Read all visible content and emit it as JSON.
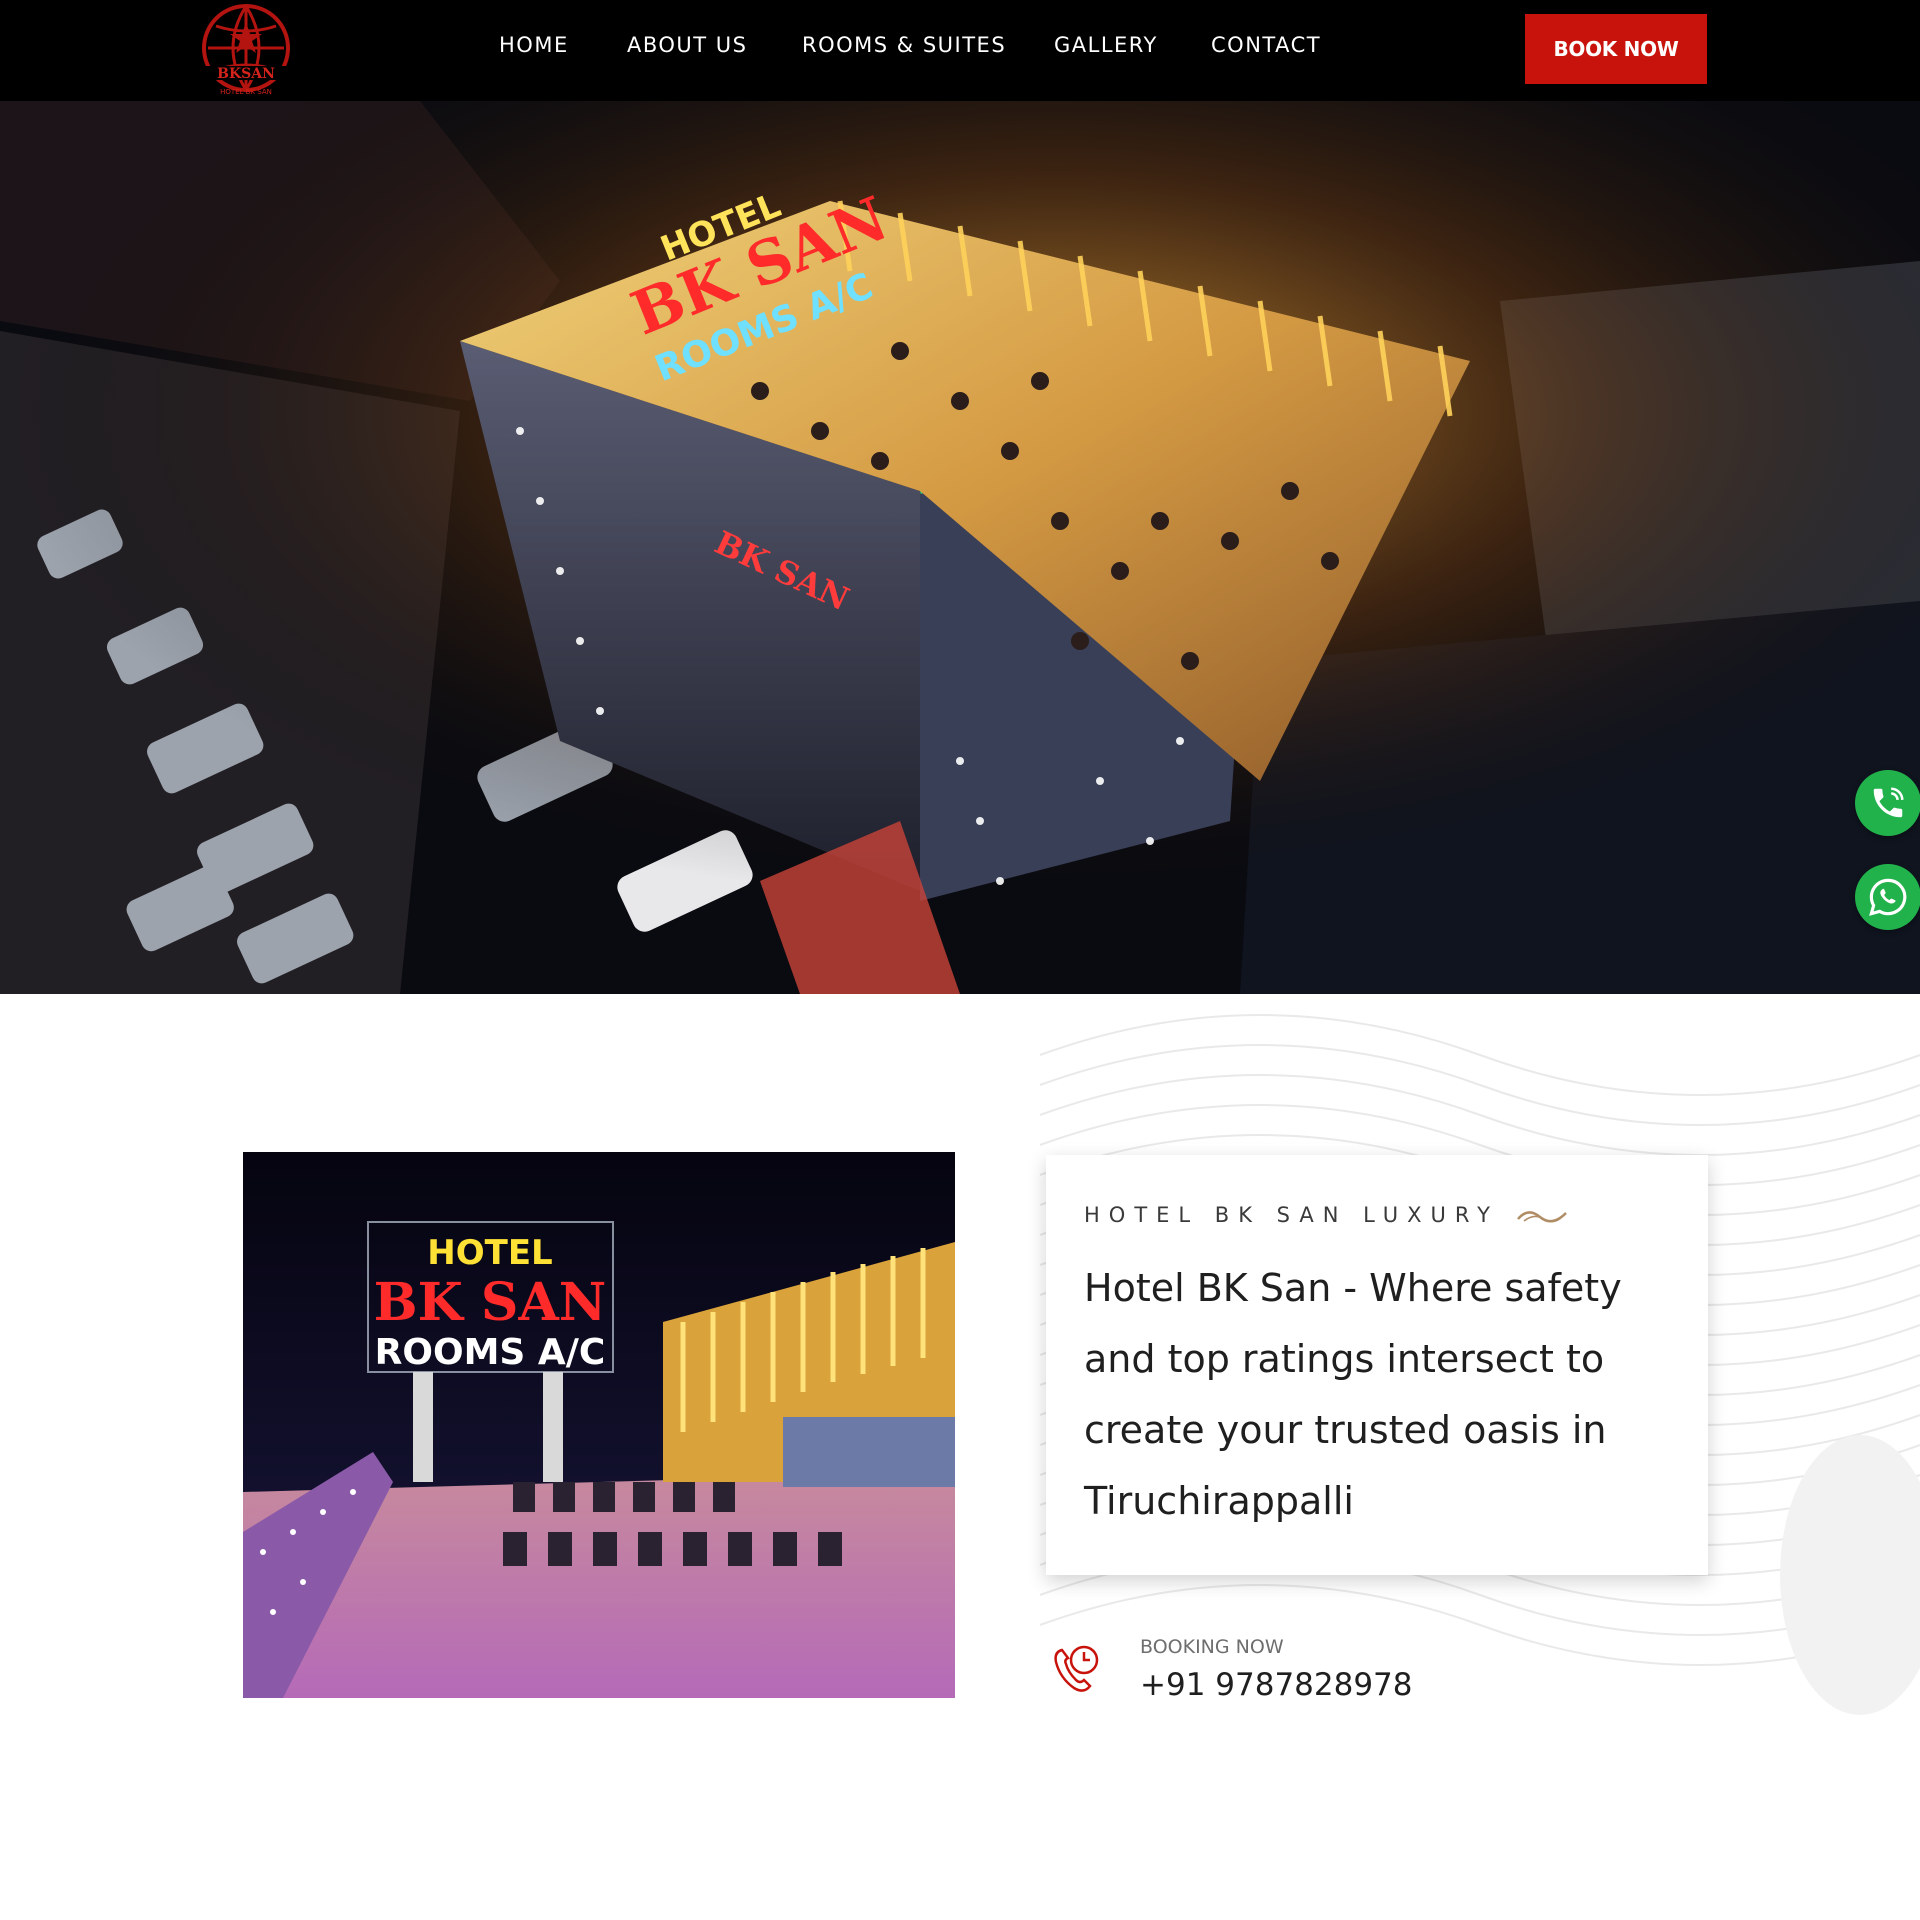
{
  "brand": {
    "logo_alt": "Hotel BK San logo",
    "logo_text": "BKSAN",
    "logo_subtext": "HOTEL BK SAN"
  },
  "nav": {
    "items": [
      {
        "label": "HOME"
      },
      {
        "label": "ABOUT US"
      },
      {
        "label": "ROOMS & SUITES"
      },
      {
        "label": "GALLERY"
      },
      {
        "label": "CONTACT"
      }
    ],
    "book_label": "BOOK NOW"
  },
  "hero": {
    "image_alt": "Aerial night view of Hotel BK San rooftop with illuminated signage",
    "sign_line1": "HOTEL",
    "sign_line2": "BK SAN",
    "sign_line3": "ROOMS A/C",
    "plaza_sign": "BK SAN"
  },
  "floating": {
    "call_icon": "phone-icon",
    "whatsapp_icon": "whatsapp-icon"
  },
  "about": {
    "photo_alt": "Hotel BK San rooftop dining terrace at night",
    "photo_sign_line1": "HOTEL",
    "photo_sign_line2": "BK SAN",
    "photo_sign_line3": "ROOMS A/C",
    "eyebrow": "HOTEL BK SAN LUXURY",
    "headline": "Hotel BK San - Where safety and top ratings intersect to create your trusted oasis in Tiruchirappalli"
  },
  "booking": {
    "label": "BOOKING NOW",
    "phone": "+91 9787828978"
  },
  "colors": {
    "accent": "#c8130c",
    "whatsapp": "#21b24b",
    "header_bg": "#000000"
  }
}
